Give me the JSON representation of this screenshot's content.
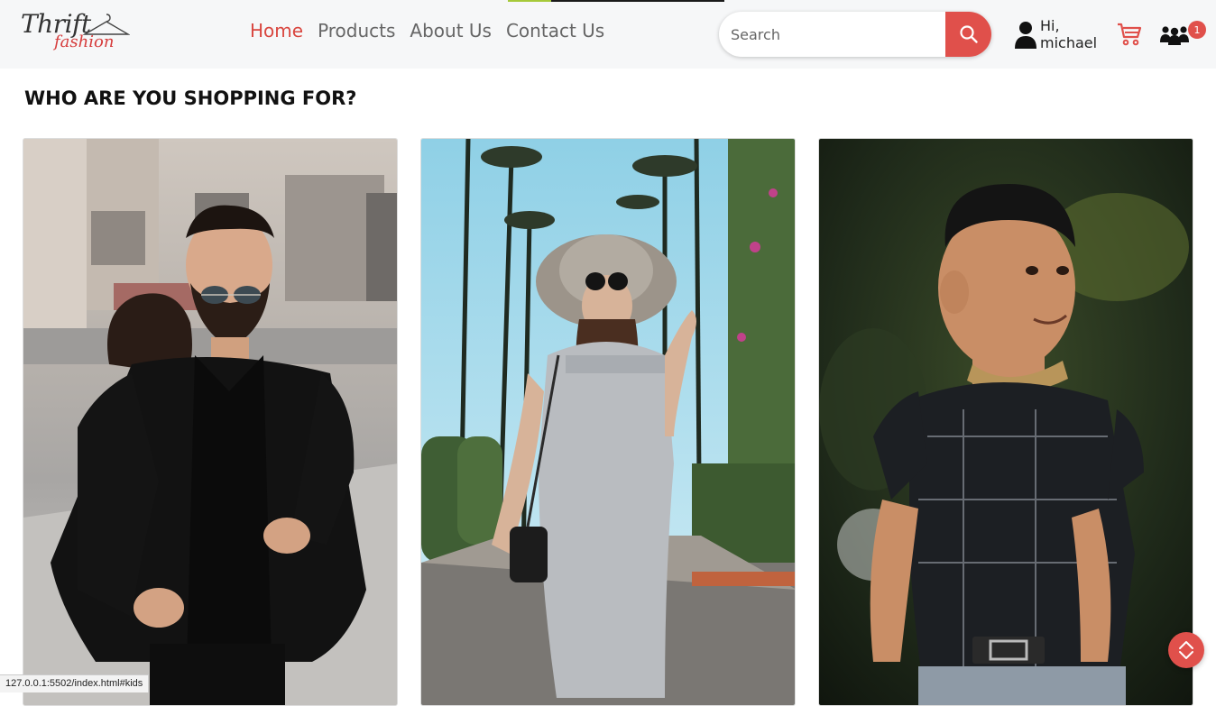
{
  "brand": {
    "logo_word1": "Thrift",
    "logo_word2": "fashion",
    "accent_color": "#e0504b"
  },
  "nav": {
    "links": [
      {
        "label": "Home",
        "active": true
      },
      {
        "label": "Products",
        "active": false
      },
      {
        "label": "About Us",
        "active": false
      },
      {
        "label": "Contact Us",
        "active": false
      }
    ]
  },
  "search": {
    "placeholder": "Search",
    "icon": "search-icon"
  },
  "user": {
    "greeting": "Hi,",
    "name": "michael",
    "icon": "user-icon"
  },
  "cart": {
    "icon": "cart-icon"
  },
  "group": {
    "icon": "users-group-icon",
    "badge_count": "1"
  },
  "main": {
    "heading": "WHO ARE YOU SHOPPING FOR?",
    "cards": [
      {
        "category": "men",
        "image_alt": "Man in black suit and sunglasses"
      },
      {
        "category": "women",
        "image_alt": "Woman in gray dress with sun hat"
      },
      {
        "category": "kids",
        "image_alt": "Young boy in dark patterned shirt"
      }
    ]
  },
  "status_bar": {
    "url": "127.0.0.1:5502/index.html#kids"
  },
  "scroll_button": {
    "icon": "scroll-up-down-icon"
  }
}
